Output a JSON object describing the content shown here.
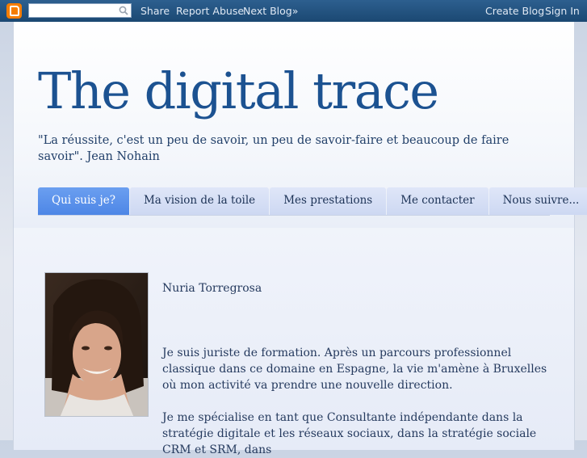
{
  "navbar": {
    "search": {
      "placeholder": "",
      "value": ""
    },
    "links": {
      "share": "Share",
      "report_abuse": "Report Abuse",
      "next_blog": "Next Blog»"
    },
    "right_links": {
      "create_blog": "Create Blog",
      "sign_in": "Sign In"
    },
    "icons": {
      "logo": "blogger-logo-icon",
      "search": "search-icon"
    },
    "colors": {
      "bar": "#1f4e7a",
      "logo": "#f57d00"
    }
  },
  "blog": {
    "title": "The digital trace",
    "description": "\"La réussite, c'est un peu de savoir, un peu de savoir-faire et beaucoup de faire savoir\". Jean Nohain",
    "colors": {
      "title": "#1c5291",
      "active_tab": "#5a90ea",
      "tab": "#d6dff5"
    }
  },
  "tabs": [
    {
      "label": "Qui suis je?",
      "active": true
    },
    {
      "label": "Ma vision de la toile",
      "active": false
    },
    {
      "label": "Mes prestations",
      "active": false
    },
    {
      "label": "Me contacter",
      "active": false
    },
    {
      "label": "Nous suivre...",
      "active": false
    }
  ],
  "post": {
    "name": "Nuria Torregrosa",
    "paragraph_1": "Je suis juriste de formation. Après un parcours professionnel classique dans ce domaine en Espagne, la vie m'amène à Bruxelles où mon activité va prendre une nouvelle direction.",
    "paragraph_2": "Je me spécialise en tant que Consultante indépendante dans la stratégie digitale et les réseaux sociaux, dans la stratégie sociale CRM et SRM, dans"
  }
}
